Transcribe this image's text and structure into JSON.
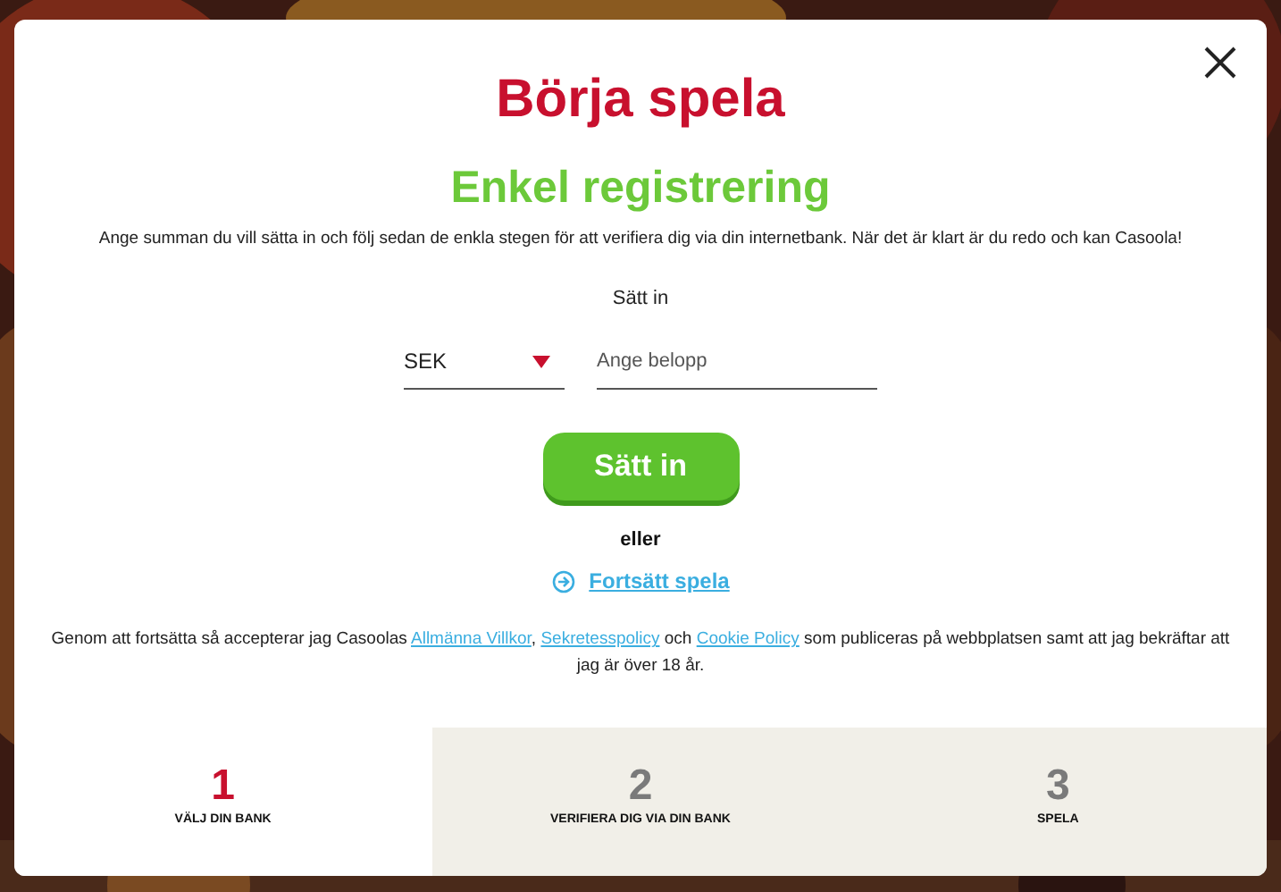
{
  "title": "Börja spela",
  "subtitle": "Enkel registrering",
  "intro": "Ange summan du vill sätta in och följ sedan de enkla stegen för att verifiera dig via din internetbank. När det är klart är du redo och kan Casoola!",
  "deposit": {
    "label": "Sätt in",
    "currency": "SEK",
    "placeholder": "Ange belopp",
    "button": "Sätt in"
  },
  "or": "eller",
  "continue_link": "Fortsätt spela",
  "terms": {
    "before": "Genom att fortsätta så accepterar jag Casoolas",
    "link_1": "Allmänna Villkor",
    "sep": ",",
    "link_2": "Sekretesspolicy",
    "mid": "och",
    "link_3": "Cookie Policy",
    "after": "som publiceras på webbplatsen samt att jag bekräftar att jag är över 18 år."
  },
  "steps": [
    {
      "number": "1",
      "label": "VÄLJ DIN BANK",
      "selected": true
    },
    {
      "number": "2",
      "label": "VERIFIERA DIG VIA DIN BANK",
      "selected": false
    },
    {
      "number": "3",
      "label": "SPELA",
      "selected": false
    }
  ]
}
